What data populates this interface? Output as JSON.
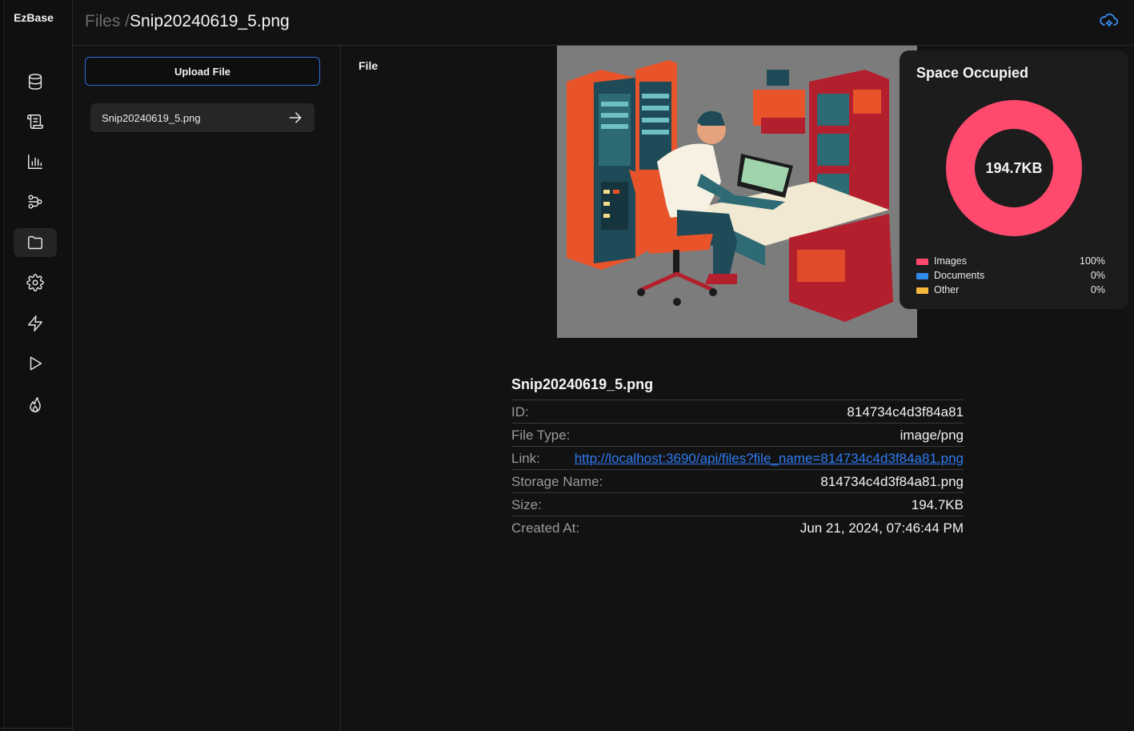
{
  "app": {
    "name": "EzBase"
  },
  "breadcrumb": {
    "root": "Files /",
    "current": "Snip20240619_5.png"
  },
  "sidebar": {
    "items": [
      {
        "icon": "database-icon"
      },
      {
        "icon": "scroll-icon"
      },
      {
        "icon": "bar-chart-icon"
      },
      {
        "icon": "workflow-icon"
      },
      {
        "icon": "folder-icon",
        "active": true
      },
      {
        "icon": "gear-icon"
      },
      {
        "icon": "bolt-icon"
      },
      {
        "icon": "play-icon"
      },
      {
        "icon": "flame-icon"
      }
    ]
  },
  "files_panel": {
    "upload_label": "Upload File",
    "files": [
      {
        "name": "Snip20240619_5.png"
      }
    ]
  },
  "main": {
    "section_label": "File",
    "preview_alt": "illustration"
  },
  "space": {
    "title": "Space Occupied",
    "total": "194.7KB",
    "legend": [
      {
        "label": "Images",
        "pct": "100%",
        "color": "#ff4a6e",
        "value": 100
      },
      {
        "label": "Documents",
        "pct": "0%",
        "color": "#2f8bea",
        "value": 0
      },
      {
        "label": "Other",
        "pct": "0%",
        "color": "#f6b93b",
        "value": 0
      }
    ]
  },
  "details": {
    "file_name": "Snip20240619_5.png",
    "id_label": "ID:",
    "id": "814734c4d3f84a81",
    "type_label": "File Type:",
    "type": "image/png",
    "link_label": "Link:",
    "link": "http://localhost:3690/api/files?file_name=814734c4d3f84a81.png",
    "storage_label": "Storage Name:",
    "storage": "814734c4d3f84a81.png",
    "size_label": "Size:",
    "size": "194.7KB",
    "created_label": "Created At:",
    "created": "Jun 21, 2024, 07:46:44 PM"
  },
  "colors": {
    "accent": "#2f7bf0",
    "images": "#ff4a6e"
  }
}
